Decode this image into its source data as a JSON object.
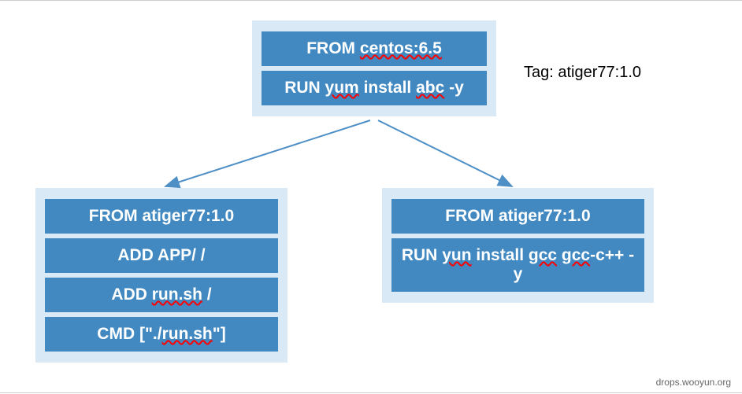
{
  "top_box": {
    "items": [
      {
        "text_pre": "FROM  ",
        "text_squiggle": "centos:6.5",
        "text_post": ""
      },
      {
        "text_pre": "RUN ",
        "text_mid": "yum",
        "text_mid2": " install ",
        "text_squiggle": "abc",
        "text_post": " -y"
      }
    ]
  },
  "tag_label": "Tag: atiger77:1.0",
  "left_box": {
    "items": [
      {
        "text_pre": "FROM atiger77:1.0"
      },
      {
        "text_pre": "ADD APP/  /"
      },
      {
        "text_pre": "ADD ",
        "text_squiggle": "run.sh",
        "text_post": "  /"
      },
      {
        "text_pre": "CMD [\"./",
        "text_squiggle": "run.sh",
        "text_post": "\"]"
      }
    ]
  },
  "right_box": {
    "items": [
      {
        "text_pre": "FROM atiger77:1.0"
      },
      {
        "text_pre": "RUN ",
        "text_squiggle": "yun",
        "text_mid": " install ",
        "text_squiggle2": "gcc",
        "text_mid2": " ",
        "text_squiggle3": "gcc",
        "text_post": "-c++ -y"
      }
    ]
  },
  "watermark": "drops.wooyun.org",
  "colors": {
    "box_bg": "#d9e9f5",
    "item_bg": "#4289c1",
    "arrow": "#4e8fc6"
  }
}
